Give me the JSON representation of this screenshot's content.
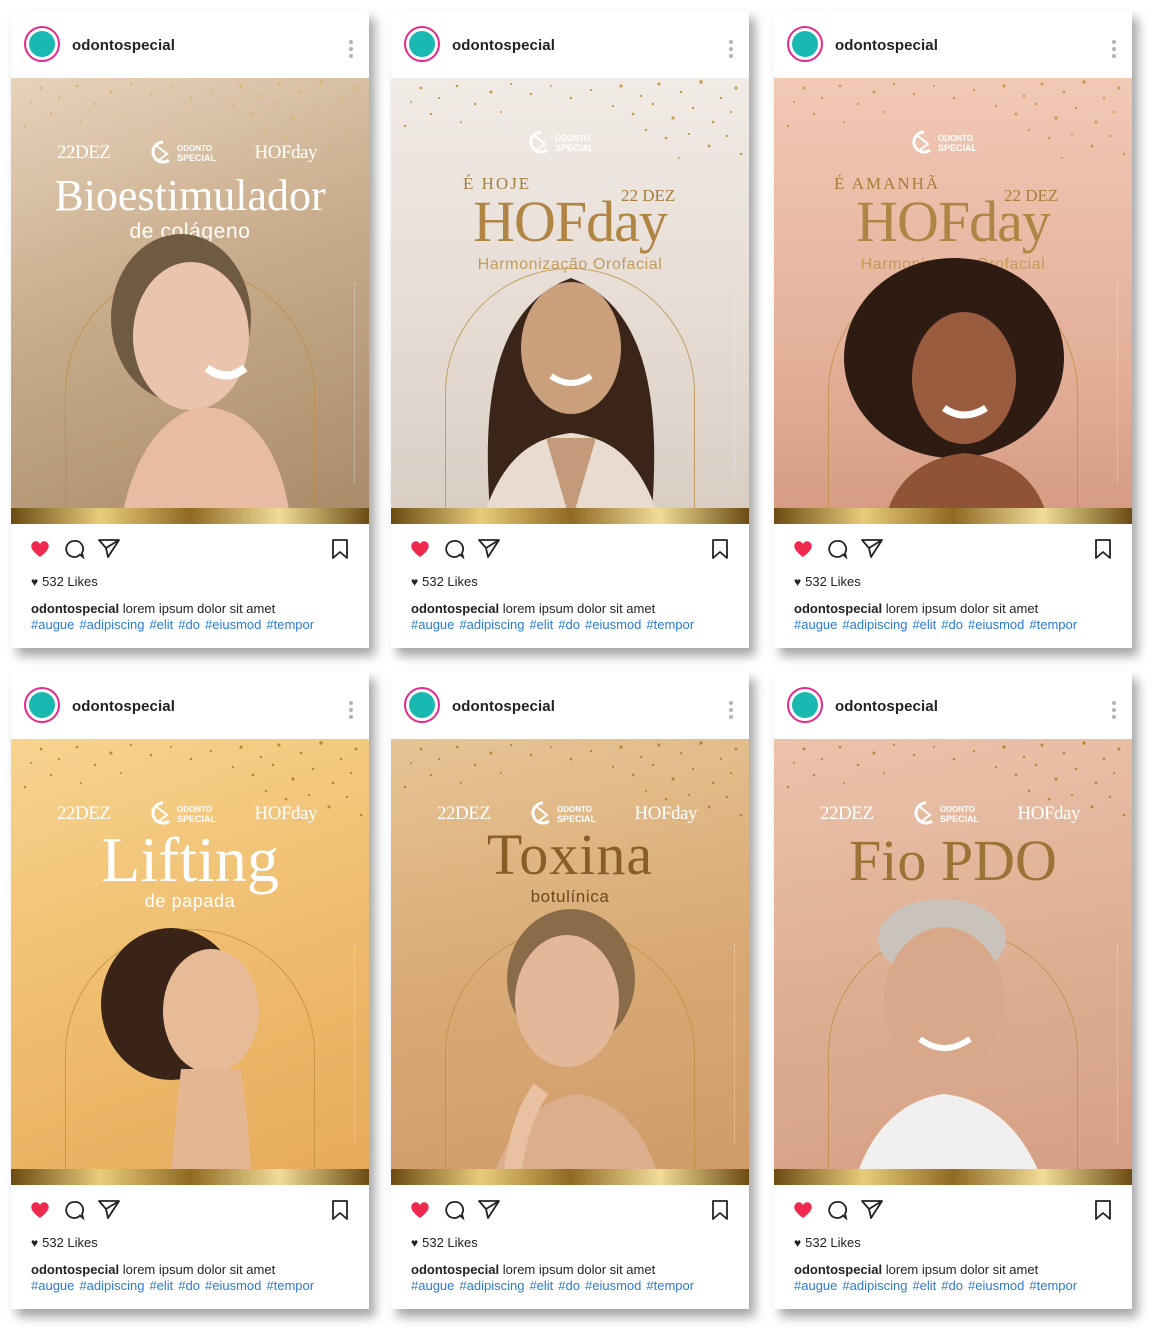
{
  "account": "odontospecial",
  "likes": "532 Likes",
  "caption_text": "lorem ipsum dolor sit amet",
  "hashtags": [
    "#augue",
    "#adipiscing",
    "#elit",
    "#do",
    "#eiusmod",
    "#tempor"
  ],
  "brand": {
    "date": "22DEZ",
    "hof": "HOFday",
    "logo_top": "ODONTO",
    "logo_bottom": "SPECIAL"
  },
  "colors": {
    "like_red": "#f0294f",
    "avatar_teal": "#19b9b2",
    "avatar_ring": "#e5288c",
    "hashtag_blue": "#2a7ad6"
  },
  "posts": [
    {
      "title": "Bioestimulador",
      "subtitle": "de colágeno"
    },
    {
      "kicker": "É HOJE",
      "date": "22 DEZ",
      "title": "HOFday",
      "subtitle": "Harmonização Orofacial"
    },
    {
      "kicker": "É AMANHÃ",
      "date": "22 DEZ",
      "title": "HOFday",
      "subtitle": "Harmonização Orofacial"
    },
    {
      "title": "Lifting",
      "subtitle": "de papada"
    },
    {
      "title": "Toxina",
      "subtitle": "botulínica"
    },
    {
      "title": "Fio PDO"
    }
  ]
}
